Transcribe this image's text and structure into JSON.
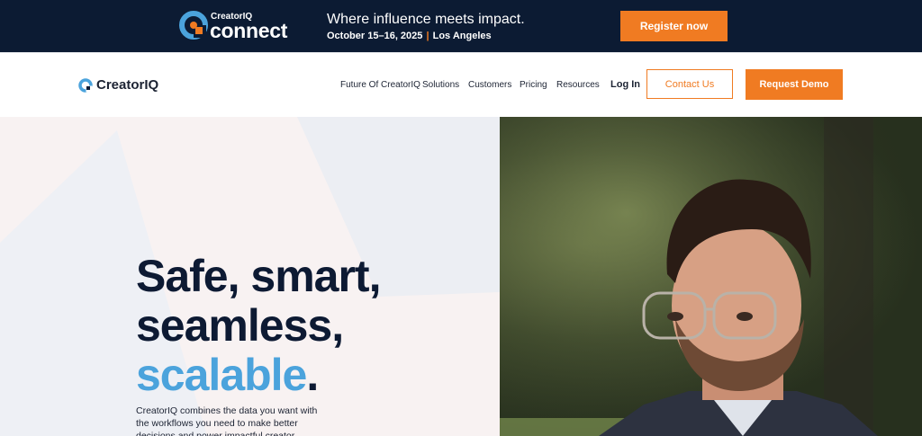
{
  "banner": {
    "brand_small": "CreatorIQ",
    "brand_big": "connect",
    "tagline": "Where influence meets impact.",
    "date": "October 15–16, 2025",
    "location": "Los Angeles",
    "register_label": "Register now"
  },
  "nav": {
    "logo_text": "CreatorIQ",
    "links": [
      "Future Of CreatorIQ",
      "Solutions",
      "Customers",
      "Pricing",
      "Resources"
    ],
    "login_label": "Log In",
    "contact_label": "Contact Us",
    "demo_label": "Request Demo"
  },
  "hero": {
    "line1": "Safe, smart,",
    "line2": "seamless,",
    "line3_highlight": "scalable",
    "line3_punct": ".",
    "body": "CreatorIQ combines the data you want with the workflows you need to make better decisions and power impactful creator"
  },
  "colors": {
    "banner_bg": "#0c1b33",
    "accent": "#f07b22",
    "highlight_blue": "#4ba3dc",
    "headline": "#0d1a33"
  }
}
